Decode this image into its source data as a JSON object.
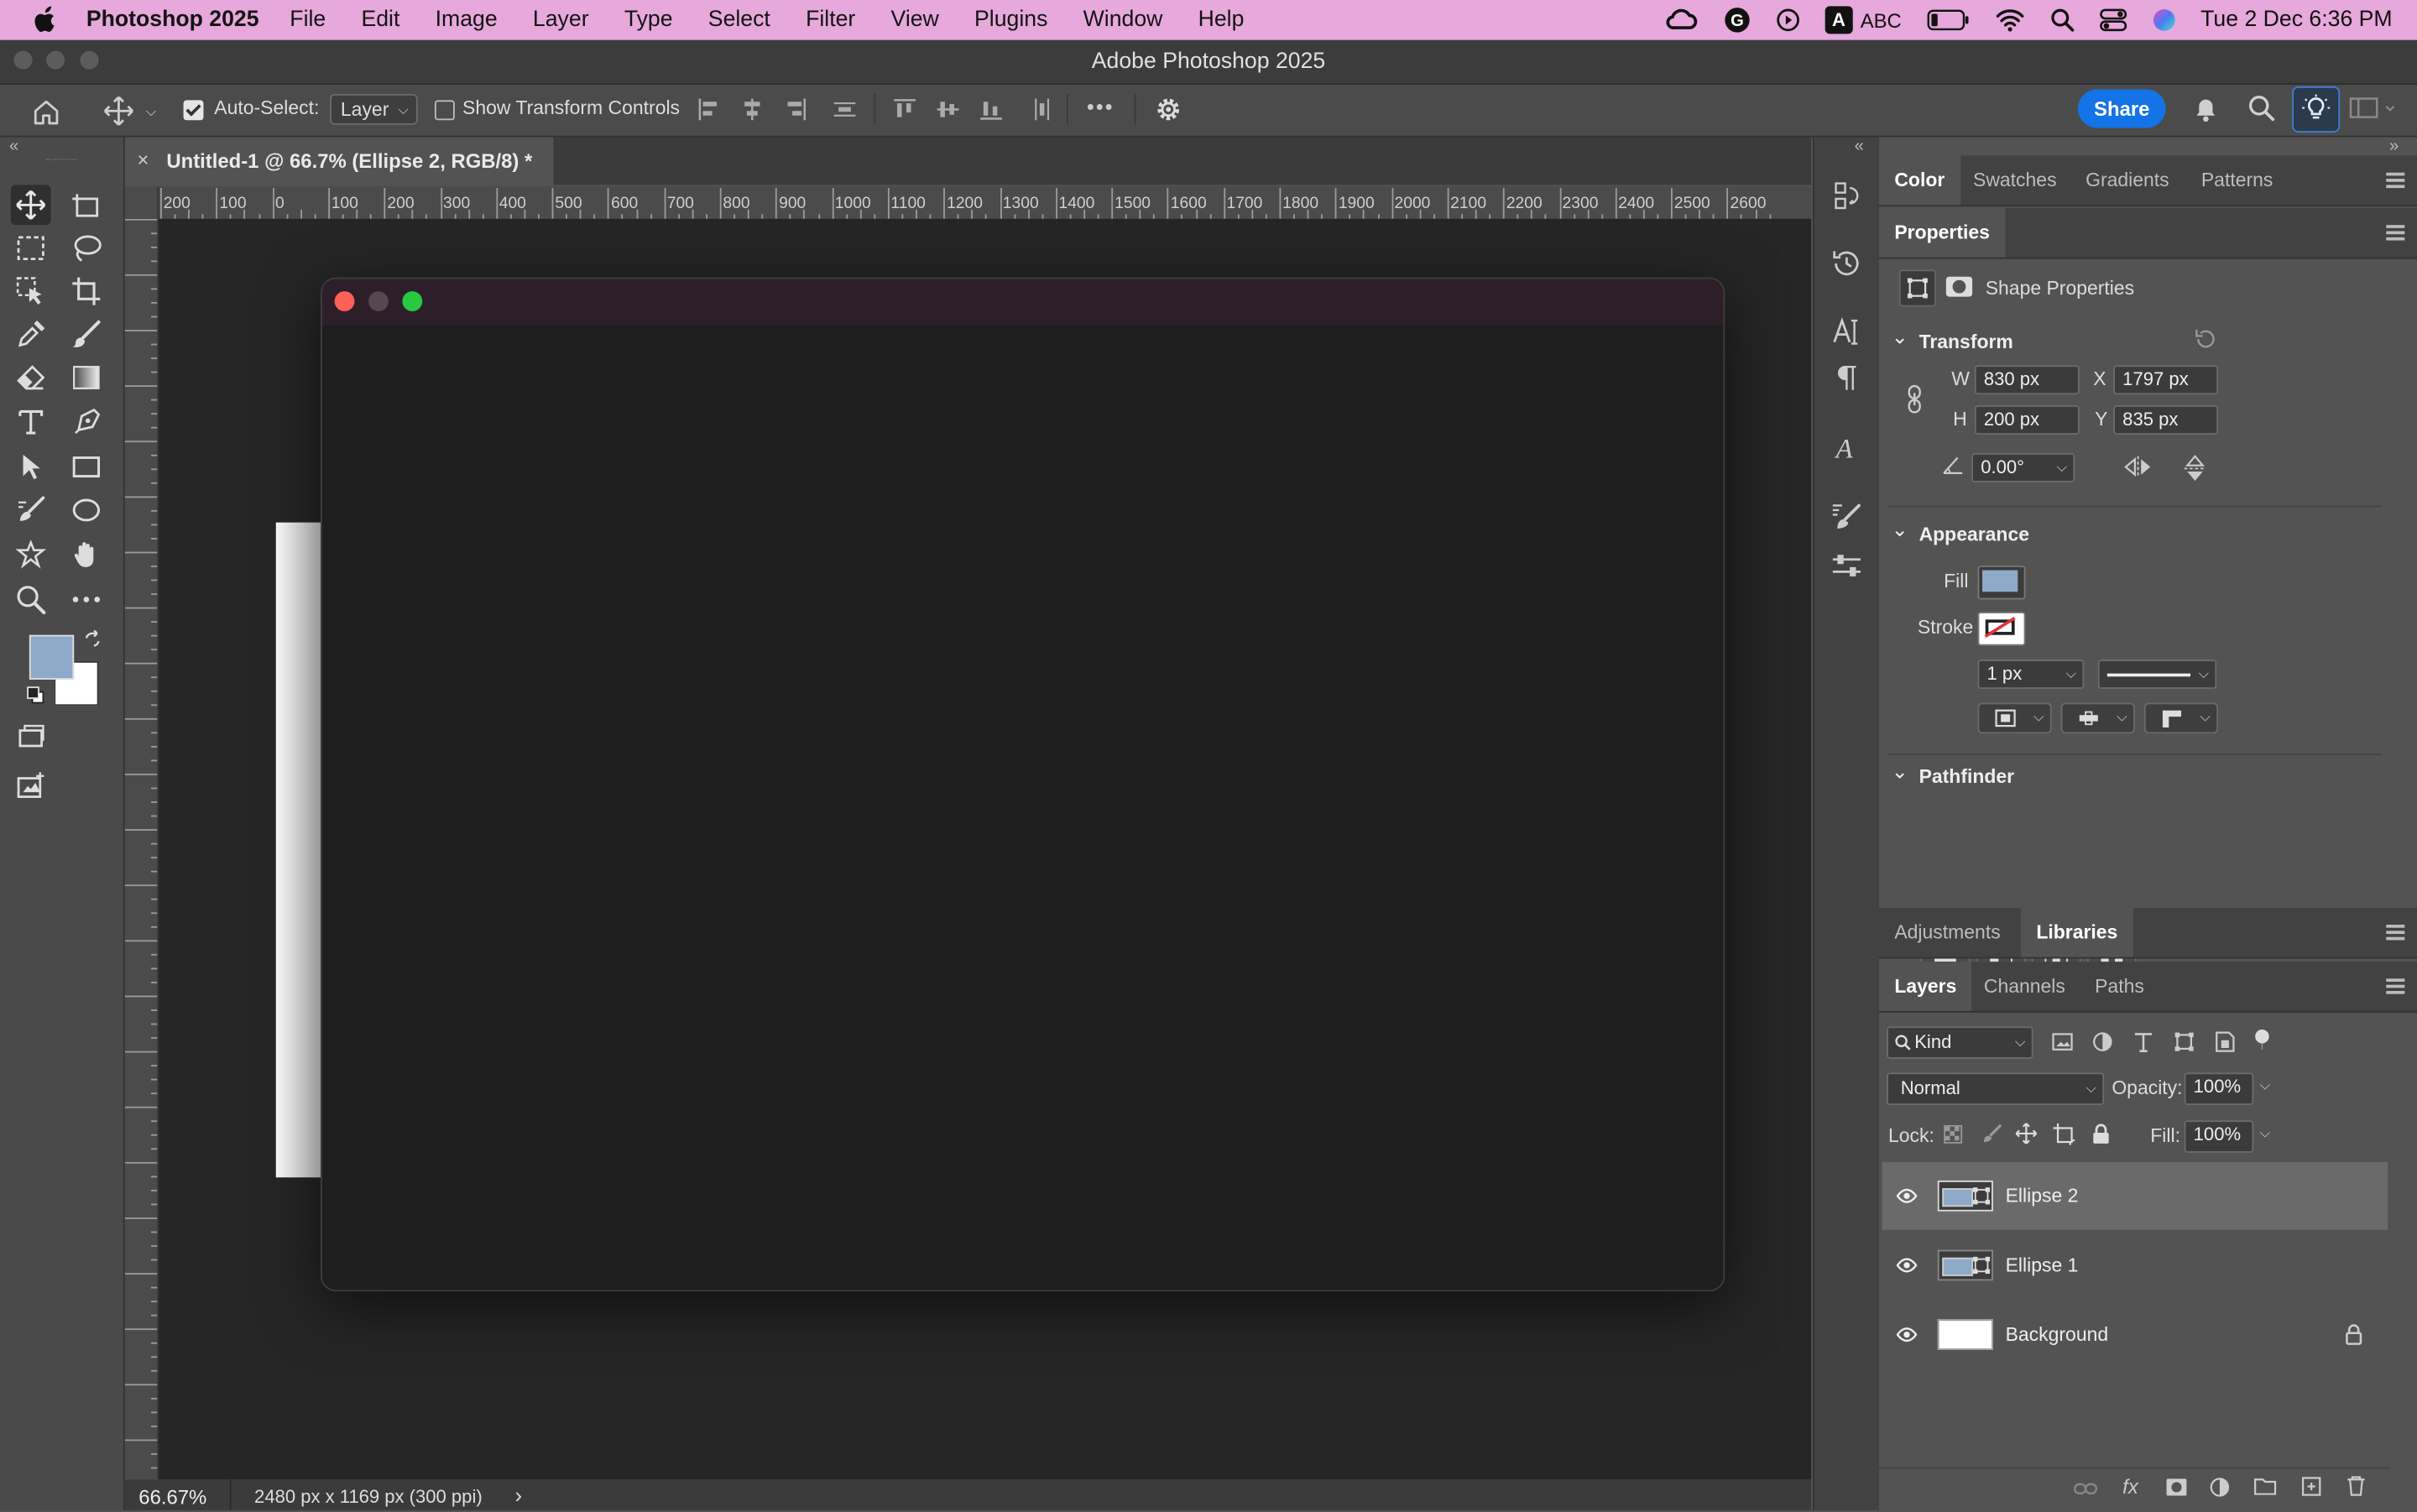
{
  "menubar": {
    "app_name": "Photoshop 2025",
    "items": [
      "File",
      "Edit",
      "Image",
      "Layer",
      "Type",
      "Select",
      "Filter",
      "View",
      "Plugins",
      "Window",
      "Help"
    ],
    "input_source": "A",
    "input_label": "ABC",
    "datetime": "Tue 2 Dec  6:36 PM"
  },
  "window": {
    "title": "Adobe Photoshop 2025"
  },
  "options": {
    "auto_select_label": "Auto-Select:",
    "auto_select_value": "Layer",
    "transform_controls_label": "Show Transform Controls",
    "share_label": "Share",
    "more_label": "•••"
  },
  "document": {
    "tab_title": "Untitled-1 @ 66.7% (Ellipse 2, RGB/8) *",
    "close_glyph": "×"
  },
  "ruler": {
    "h_ticks": [
      "200",
      "100",
      "0",
      "100",
      "200",
      "300",
      "400",
      "500",
      "600",
      "700",
      "800",
      "900",
      "1000",
      "1100",
      "1200",
      "1300",
      "1400",
      "1500",
      "1600",
      "1700",
      "1800",
      "1900",
      "2000",
      "2100",
      "2200",
      "2300",
      "2400",
      "2500",
      "2600"
    ]
  },
  "status": {
    "zoom": "66.67%",
    "doc_info": "2480 px x 1169 px (300 ppi)",
    "arrow": "›"
  },
  "panels": {
    "color_tabs": [
      "Color",
      "Swatches",
      "Gradients",
      "Patterns"
    ],
    "properties_tab": "Properties",
    "shape_properties_label": "Shape Properties",
    "transform": {
      "title": "Transform",
      "w_label": "W",
      "w_value": "830 px",
      "x_label": "X",
      "x_value": "1797 px",
      "h_label": "H",
      "h_value": "200 px",
      "y_label": "Y",
      "y_value": "835 px",
      "angle_value": "0.00°"
    },
    "appearance": {
      "title": "Appearance",
      "fill_label": "Fill",
      "stroke_label": "Stroke",
      "fill_color": "#8fa9c8",
      "stroke_width": "1 px"
    },
    "pathfinder_title": "Pathfinder",
    "adjust_tabs": [
      "Adjustments",
      "Libraries"
    ],
    "layer_tabs": [
      "Layers",
      "Channels",
      "Paths"
    ],
    "filter_kind": "Kind",
    "blend_mode": "Normal",
    "opacity_label": "Opacity:",
    "opacity_value": "100%",
    "lock_label": "Lock:",
    "fill_label": "Fill:",
    "fill_value": "100%",
    "layers": [
      {
        "name": "Ellipse 2",
        "selected": true
      },
      {
        "name": "Ellipse 1",
        "selected": false
      },
      {
        "name": "Background",
        "selected": false
      }
    ]
  },
  "colors": {
    "foreground": "#8fa9c8",
    "background": "#ffffff",
    "accent": "#1473e6",
    "menubar": "#e7a8dc"
  }
}
